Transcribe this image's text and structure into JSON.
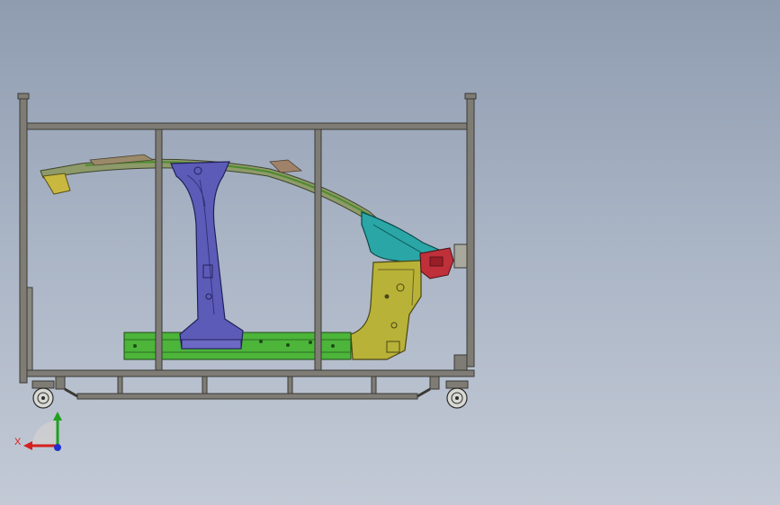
{
  "viewport": {
    "background_top": "#8f9cb0",
    "background_bottom": "#c3cad6"
  },
  "model": {
    "frame_color": "#7e7c74",
    "frame_edge": "#3a3a36",
    "pillar_color": "#5d5bb8",
    "roof_rail_color": "#6c8a4a",
    "sill_color": "#4cb53a",
    "front_pillar_color": "#b8b238",
    "cowl_color": "#2aa6a6",
    "bracket_color": "#c0303a"
  },
  "triad": {
    "x_label": "X",
    "x_color": "#d42020",
    "y_color": "#20a020",
    "z_color": "#2030d0"
  }
}
